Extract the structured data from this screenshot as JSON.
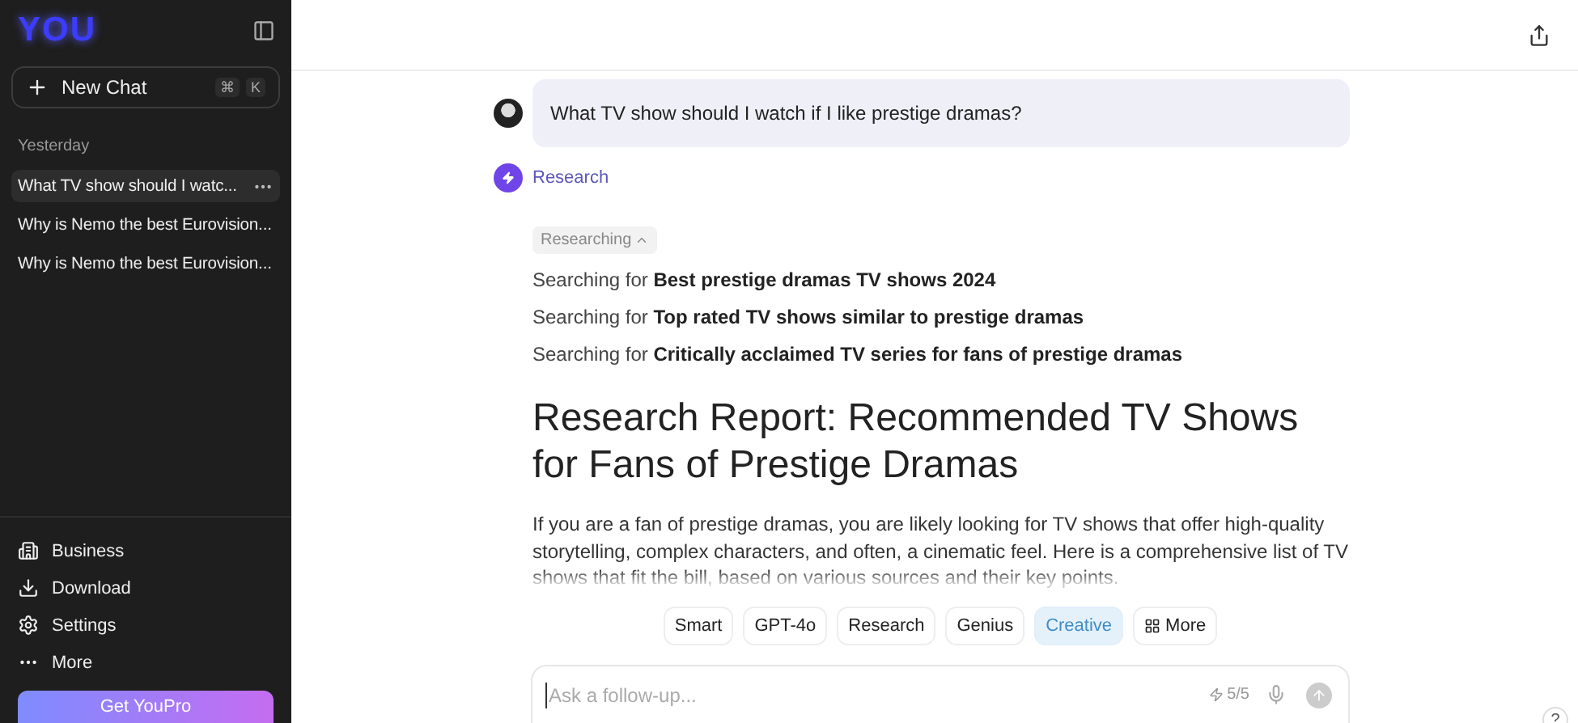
{
  "sidebar": {
    "logo": "YOU",
    "new_chat": {
      "label": "New Chat",
      "shortcut": [
        "⌘",
        "K"
      ]
    },
    "history_group": "Yesterday",
    "history": [
      {
        "title": "What TV show should I watc...",
        "selected": true
      },
      {
        "title": "Why is Nemo the best Eurovision...",
        "selected": false
      },
      {
        "title": "Why is Nemo the best Eurovision...",
        "selected": false
      }
    ],
    "footer_items": [
      {
        "label": "Business",
        "kind": "business"
      },
      {
        "label": "Download",
        "kind": "download"
      },
      {
        "label": "Settings",
        "kind": "settings"
      },
      {
        "label": "More",
        "kind": "more"
      }
    ],
    "upgrade_button": "Get YouPro"
  },
  "chat": {
    "question": "What TV show should I watch if I like prestige dramas?",
    "assistant_mode": "Research",
    "status": {
      "label": "Researching",
      "expanded": true
    },
    "searches": [
      {
        "prefix": "Searching for",
        "query": "Best prestige dramas TV shows 2024"
      },
      {
        "prefix": "Searching for",
        "query": "Top rated TV shows similar to prestige dramas"
      },
      {
        "prefix": "Searching for",
        "query": "Critically acclaimed TV series for fans of prestige dramas"
      }
    ],
    "heading": "Research Report: Recommended TV Shows for Fans of Prestige Dramas",
    "paragraph": "If you are a fan of prestige dramas, you are likely looking for TV shows that offer high-quality storytelling, complex characters, and often, a cinematic feel. Here is a comprehensive list of TV shows that fit the bill, based on various sources and their key points."
  },
  "modes": [
    {
      "label": "Smart",
      "selected": false
    },
    {
      "label": "GPT-4o",
      "selected": false
    },
    {
      "label": "Research",
      "selected": false
    },
    {
      "label": "Genius",
      "selected": false
    },
    {
      "label": "Creative",
      "selected": true
    },
    {
      "label": "More",
      "selected": false,
      "kind": "more"
    }
  ],
  "composer": {
    "placeholder": "Ask a follow-up...",
    "credits": "5/5"
  },
  "help_button": "?"
}
